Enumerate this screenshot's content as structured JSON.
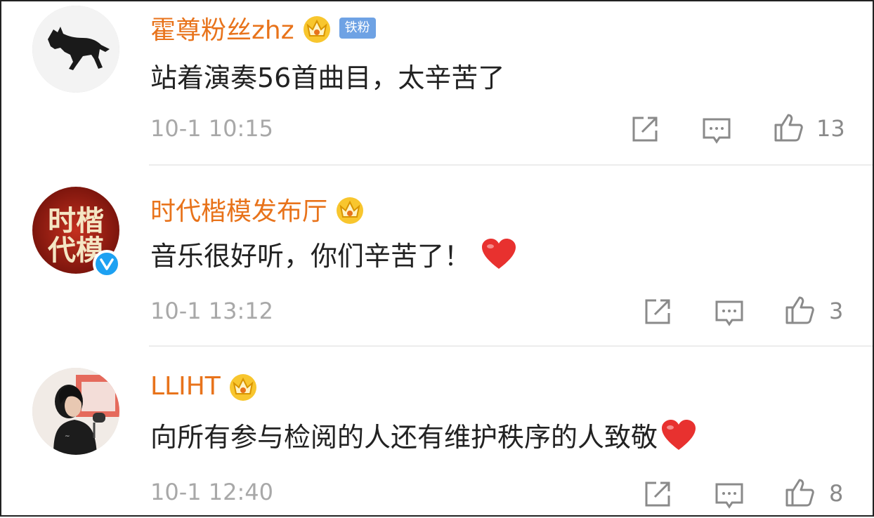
{
  "comments": [
    {
      "username": "霍尊粉丝zhz",
      "badge": "铁粉",
      "text": "站着演奏56首曲目，太辛苦了",
      "time": "10-1 10:15",
      "likes": "13",
      "avatar_icon": "horse-icon",
      "verified": false
    },
    {
      "username": "时代楷模发布厅",
      "text": "音乐很好听，你们辛苦了！",
      "time": "10-1 13:12",
      "likes": "3",
      "avatar_icon": "shidai-kaimo-logo",
      "avatar_text": [
        "时",
        "楷",
        "代",
        "模"
      ],
      "verified": true
    },
    {
      "username": "LLIHT",
      "text": "向所有参与检阅的人还有维护秩序的人致敬",
      "time": "10-1 12:40",
      "likes": "8",
      "avatar_icon": "person-photo",
      "verified": false
    }
  ],
  "colors": {
    "username": "#e8731b",
    "crown": "#f5b400",
    "heart": "#e8312f",
    "verified": "#1da1f2",
    "meta": "#a8a8a8"
  }
}
